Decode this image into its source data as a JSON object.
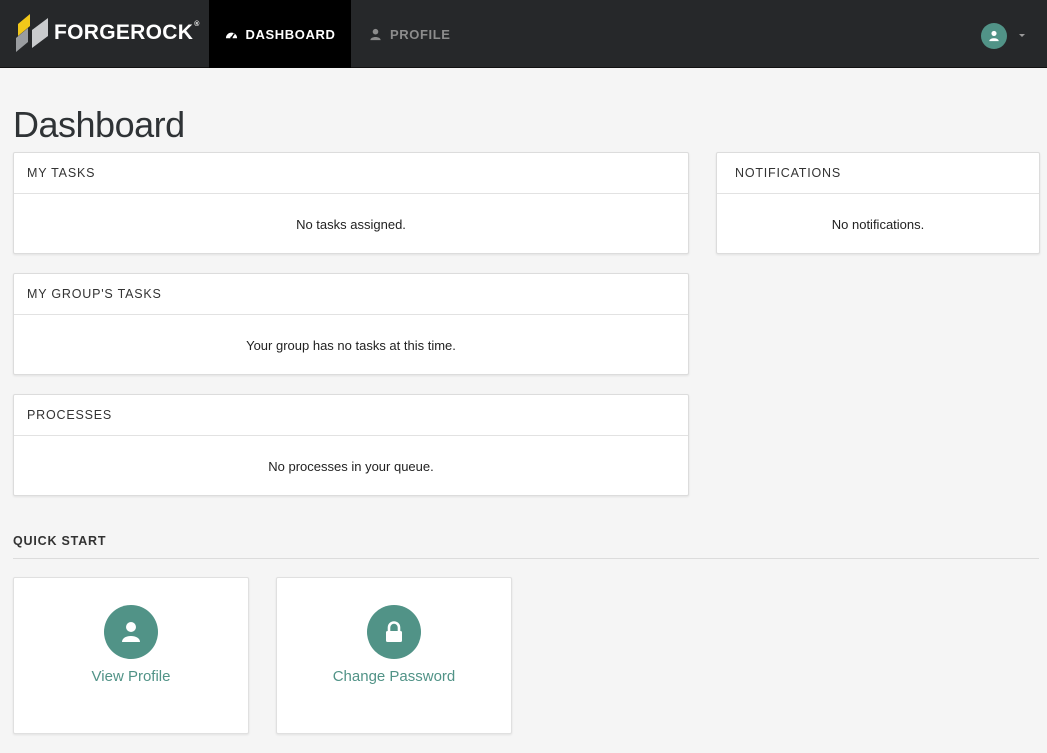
{
  "brand": {
    "name": "FORGEROCK",
    "reg": "®"
  },
  "nav": {
    "dashboard": "DASHBOARD",
    "profile": "PROFILE"
  },
  "page": {
    "title": "Dashboard"
  },
  "panels": {
    "my_tasks": {
      "title": "MY TASKS",
      "message": "No tasks assigned."
    },
    "group_tasks": {
      "title": "MY GROUP'S TASKS",
      "message": "Your group has no tasks at this time."
    },
    "processes": {
      "title": "PROCESSES",
      "message": "No processes in your queue."
    },
    "notifications": {
      "title": "NOTIFICATIONS",
      "message": "No notifications."
    }
  },
  "quick_start": {
    "title": "QUICK START",
    "cards": [
      {
        "label": "View Profile",
        "icon": "user-icon"
      },
      {
        "label": "Change Password",
        "icon": "lock-icon"
      }
    ]
  },
  "colors": {
    "topbar": "#26282a",
    "accent": "#519387",
    "background": "#f5f5f5"
  }
}
